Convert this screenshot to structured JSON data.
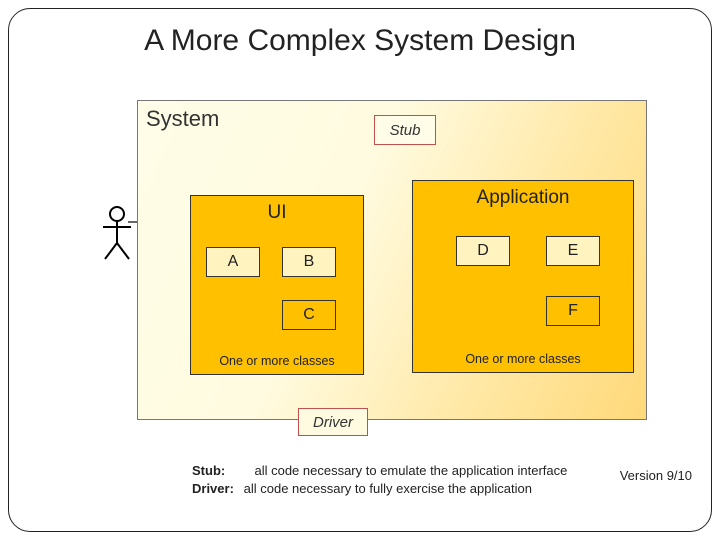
{
  "title": "A More Complex System Design",
  "system_label": "System",
  "stub_label": "Stub",
  "driver_label": "Driver",
  "ui": {
    "label": "UI",
    "boxes": {
      "a": "A",
      "b": "B",
      "c": "C"
    },
    "note": "One or more classes"
  },
  "app": {
    "label": "Application",
    "boxes": {
      "d": "D",
      "e": "E",
      "f": "F"
    },
    "note": "One or more classes"
  },
  "footnotes": {
    "stub_term": "Stub:",
    "stub_def": "all code necessary to emulate the application interface",
    "driver_term": "Driver:",
    "driver_def": "all code necessary to fully exercise the application"
  },
  "version": "Version 9/10"
}
